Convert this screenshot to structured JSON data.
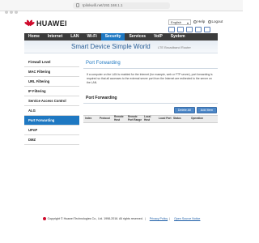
{
  "browser": {
    "url": "tplinkwifi.net/192.168.1.1"
  },
  "header": {
    "brand": "HUAWEI",
    "language": "English",
    "help_label": "Help",
    "logout_label": "Logout"
  },
  "nav": {
    "tabs": [
      {
        "label": "Home"
      },
      {
        "label": "Internet"
      },
      {
        "label": "LAN"
      },
      {
        "label": "Wi-Fi"
      },
      {
        "label": "Security"
      },
      {
        "label": "Services"
      },
      {
        "label": "VoIP"
      },
      {
        "label": "System"
      }
    ],
    "active_index": 4
  },
  "banner": {
    "slogan": "Smart Device  Simple World",
    "sub": "LTE Broadband Router"
  },
  "sidebar": {
    "items": [
      {
        "label": "Firewall Level"
      },
      {
        "label": "MAC Filtering"
      },
      {
        "label": "URL Filtering"
      },
      {
        "label": "IP Filtering"
      },
      {
        "label": "Service Access Control"
      },
      {
        "label": "ALG"
      },
      {
        "label": "Port Forwarding"
      },
      {
        "label": "UPnP"
      },
      {
        "label": "DMZ"
      }
    ],
    "active_index": 6
  },
  "content": {
    "title": "Port Forwarding",
    "description": "If a computer on the LAN is enabled for the Internet (for example, web or FTP server), port forwarding is required so that all accesses to the external server port from the Internet are redirected to the server on the LAN.",
    "section_title": "Port Forwarding",
    "delete_all_label": "Delete All",
    "add_item_label": "Add Item",
    "columns": [
      "Index",
      "Protocol",
      "Remote Host",
      "Remote Port Range",
      "Local Host",
      "Local Port",
      "Status",
      "Operation"
    ]
  },
  "footer": {
    "copyright": "Copyright © Huawei Technologies Co., Ltd. 1998-2016. All rights reserved.",
    "privacy_label": "Privacy Policy",
    "open_source_label": "Open Source Notice"
  },
  "colors": {
    "accent": "#1e78c2",
    "brand_red": "#cf0a2c",
    "nav_bg": "#3c3c3c"
  }
}
